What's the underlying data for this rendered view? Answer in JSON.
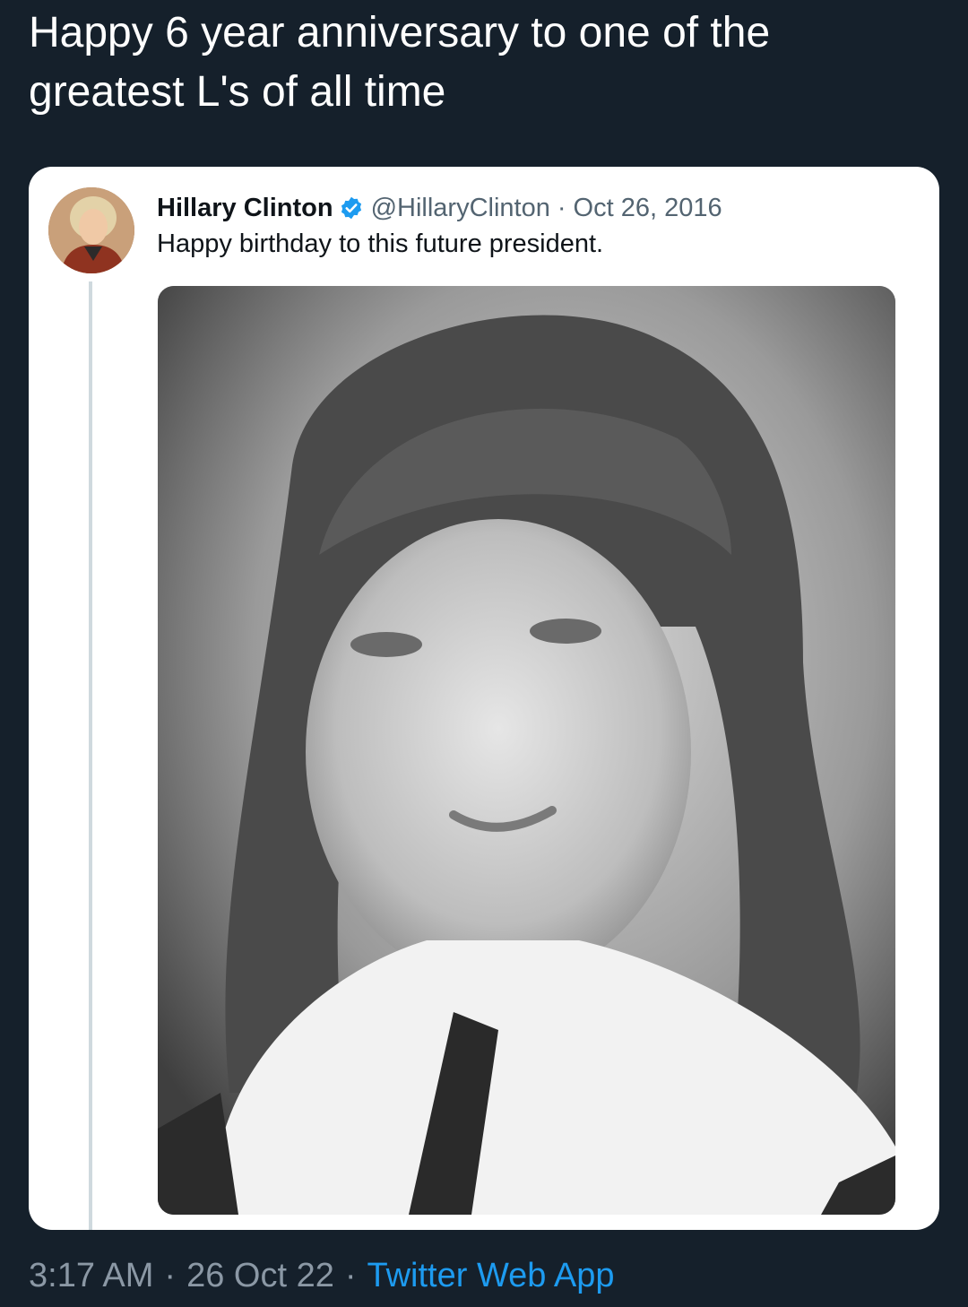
{
  "tweet": {
    "text": "Happy 6 year anniversary to one of the greatest L's of all time",
    "time": "3:17 AM",
    "date": "26 Oct 22",
    "separator": "·",
    "source": "Twitter Web App"
  },
  "quoted_tweet": {
    "author_name": "Hillary Clinton",
    "handle": "@HillaryClinton",
    "separator": "·",
    "date": "Oct 26, 2016",
    "text": "Happy birthday to this future president.",
    "verified_icon": "verified-badge-icon",
    "photo": "black-and-white portrait photo"
  },
  "colors": {
    "background": "#15202b",
    "card": "#ffffff",
    "link": "#1d9bf0",
    "verified": "#1d9bf0",
    "muted": "#8b98a5"
  }
}
